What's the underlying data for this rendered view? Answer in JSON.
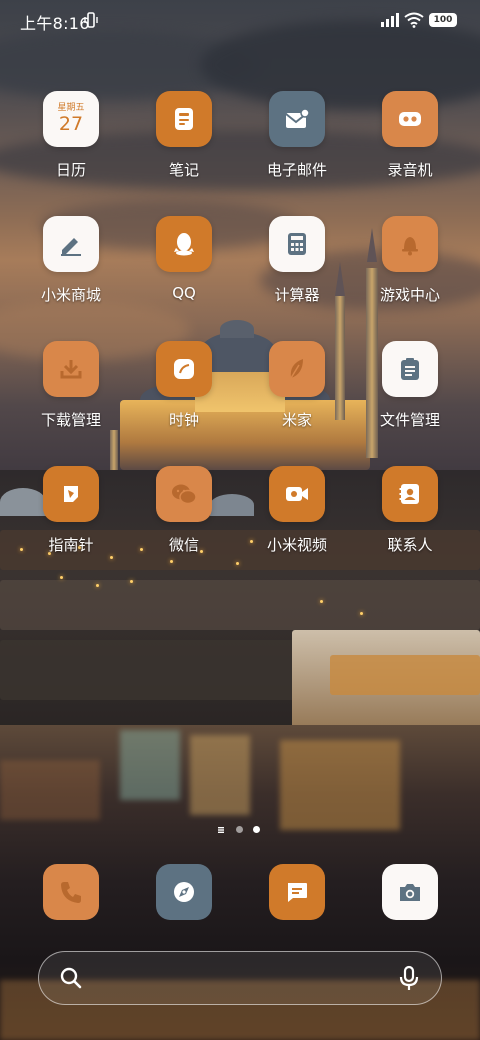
{
  "status_bar": {
    "time": "上午8:16",
    "battery": "100"
  },
  "apps": [
    {
      "label": "日历",
      "icon": "calendar-icon",
      "calendar_weekday": "星期五",
      "calendar_date": "27"
    },
    {
      "label": "笔记",
      "icon": "notes-icon"
    },
    {
      "label": "电子邮件",
      "icon": "email-icon"
    },
    {
      "label": "录音机",
      "icon": "recorder-icon"
    },
    {
      "label": "小米商城",
      "icon": "store-icon"
    },
    {
      "label": "QQ",
      "icon": "qq-icon"
    },
    {
      "label": "计算器",
      "icon": "calculator-icon"
    },
    {
      "label": "游戏中心",
      "icon": "game-center-icon"
    },
    {
      "label": "下载管理",
      "icon": "download-icon"
    },
    {
      "label": "时钟",
      "icon": "clock-icon"
    },
    {
      "label": "米家",
      "icon": "mijia-icon"
    },
    {
      "label": "文件管理",
      "icon": "file-manager-icon"
    },
    {
      "label": "指南针",
      "icon": "compass-icon"
    },
    {
      "label": "微信",
      "icon": "wechat-icon"
    },
    {
      "label": "小米视频",
      "icon": "video-icon"
    },
    {
      "label": "联系人",
      "icon": "contacts-icon"
    }
  ],
  "dock": [
    {
      "icon": "phone-icon"
    },
    {
      "icon": "browser-icon"
    },
    {
      "icon": "messages-icon"
    },
    {
      "icon": "camera-icon"
    }
  ],
  "page_indicator": {
    "pages": 2,
    "current": 2
  },
  "colors": {
    "accent_orange": "#d07a2a",
    "light_orange": "#d9874a",
    "slate": "#5d7282",
    "white_icon": "#fbf8f6"
  }
}
